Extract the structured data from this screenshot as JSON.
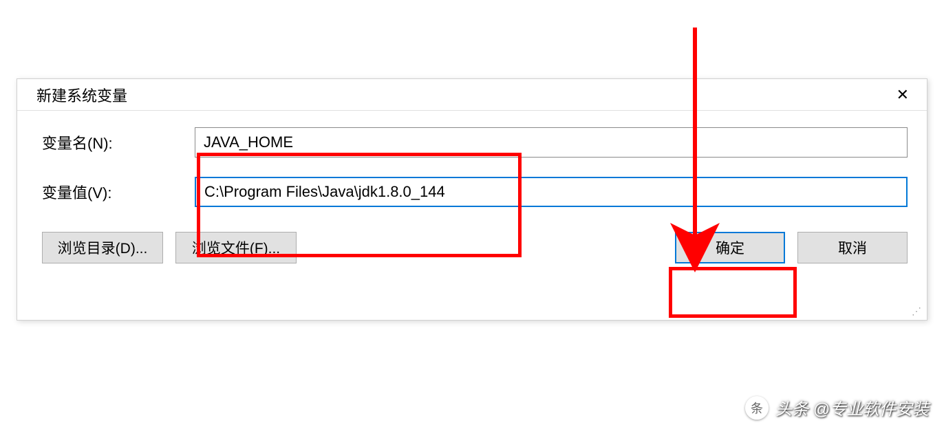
{
  "dialog": {
    "title": "新建系统变量",
    "close_glyph": "✕"
  },
  "fields": {
    "name_label": "变量名(N):",
    "name_value": "JAVA_HOME",
    "value_label": "变量值(V):",
    "value_value": "C:\\Program Files\\Java\\jdk1.8.0_144"
  },
  "buttons": {
    "browse_dir": "浏览目录(D)...",
    "browse_file": "浏览文件(F)...",
    "ok": "确定",
    "cancel": "取消"
  },
  "watermark": {
    "logo_glyph": "条",
    "text": "头条 @专业软件安装"
  },
  "annotations": {
    "highlight_inputs": true,
    "highlight_ok": true,
    "arrow_color": "#ff0000"
  }
}
